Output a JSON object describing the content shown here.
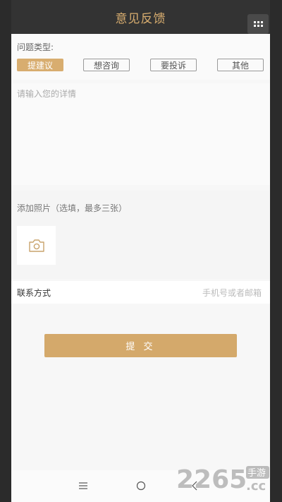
{
  "header": {
    "title": "意见反馈",
    "menu_icon": "grid-menu-icon"
  },
  "issue_type": {
    "label": "问题类型:",
    "options": [
      "提建议",
      "想咨询",
      "要投诉",
      "其他"
    ],
    "selected": "提建议",
    "accent": "#d8ad6f"
  },
  "details": {
    "placeholder": "请输入您的详情"
  },
  "photos": {
    "label": "添加照片（选填，最多三张）",
    "add_icon": "camera-icon"
  },
  "contact": {
    "label": "联系方式",
    "placeholder": "手机号或者邮箱"
  },
  "submit": {
    "label": "提 交"
  },
  "watermark": {
    "number": "2265",
    "suffix": "手游",
    "domain": ".cc"
  },
  "colors": {
    "topbar": "#333333",
    "accent": "#d8ad6f",
    "button": "#d4a96b"
  }
}
